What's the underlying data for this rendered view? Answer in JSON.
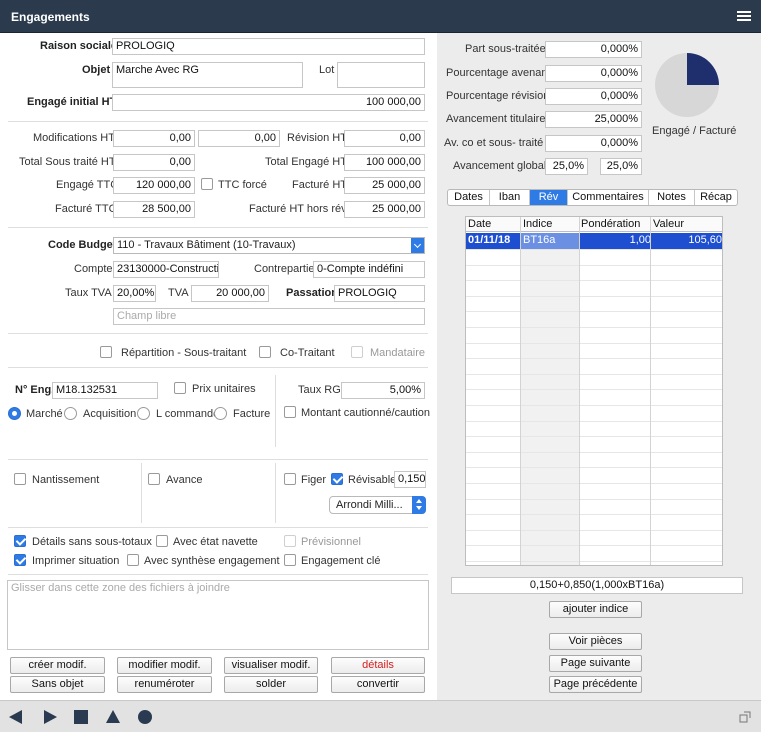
{
  "window": {
    "title": "Engagements"
  },
  "form": {
    "raison_sociale": {
      "label": "Raison sociale",
      "value": "PROLOGIQ"
    },
    "objet": {
      "label": "Objet",
      "value": "Marche Avec RG"
    },
    "lot": {
      "label": "Lot",
      "value": ""
    },
    "engage_initial": {
      "label": "Engagé initial HT",
      "value": "100 000,00"
    },
    "modifications_ht": {
      "label": "Modifications HT",
      "value1": "0,00",
      "value2": "0,00"
    },
    "revision_ht": {
      "label": "Révision HT",
      "value": "0,00"
    },
    "total_sous_traite": {
      "label": "Total Sous traité HT",
      "value": "0,00"
    },
    "total_engage_ht": {
      "label": "Total Engagé HT",
      "value": "100 000,00"
    },
    "engage_ttc": {
      "label": "Engagé TTC",
      "value": "120 000,00"
    },
    "ttc_force": {
      "label": "TTC forcé",
      "checked": false
    },
    "facture_ht": {
      "label": "Facturé HT",
      "value": "25 000,00"
    },
    "facture_ttc": {
      "label": "Facturé TTC",
      "value": "28 500,00"
    },
    "facture_ht_hors_rev": {
      "label": "Facturé HT hors rév.",
      "value": "25 000,00"
    },
    "code_budget": {
      "label": "Code Budget",
      "value": "110 - Travaux Bâtiment (10-Travaux)"
    },
    "compte": {
      "label": "Compte",
      "value": "23130000-Constructic"
    },
    "contrepartie": {
      "label": "Contrepartie",
      "value": "0-Compte indéfini"
    },
    "taux_tva": {
      "label": "Taux TVA",
      "value": "20,00%"
    },
    "tva": {
      "label": "TVA",
      "value": "20 000,00"
    },
    "passation": {
      "label": "Passation",
      "value": "PROLOGIQ"
    },
    "champ_libre": {
      "placeholder": "Champ libre"
    },
    "repartition": {
      "label": "Répartition - Sous-traitant",
      "checked": false
    },
    "co_traitant": {
      "label": "Co-Traitant",
      "checked": false
    },
    "mandataire": {
      "label": "Mandataire",
      "checked": false,
      "disabled": true
    },
    "n_eng": {
      "label": "N° Eng.",
      "value": "M18.132531"
    },
    "prix_unitaires": {
      "label": "Prix unitaires",
      "checked": false
    },
    "taux_rg": {
      "label": "Taux RG",
      "value": "5,00%"
    },
    "type_options": [
      {
        "label": "Marché",
        "selected": true
      },
      {
        "label": "Acquisition",
        "selected": false
      },
      {
        "label": "L commande",
        "selected": false
      },
      {
        "label": "Facture",
        "selected": false
      }
    ],
    "montant_caution": {
      "label": "Montant cautionné/caution",
      "checked": false
    },
    "nantissement": {
      "label": "Nantissement",
      "checked": false
    },
    "avance": {
      "label": "Avance",
      "checked": false
    },
    "figer": {
      "label": "Figer",
      "checked": false
    },
    "revisable": {
      "label": "Révisable",
      "checked": true,
      "value": "0,150"
    },
    "arrondi": {
      "value": "Arrondi Milli..."
    },
    "details_sans_sous_totaux": {
      "label": "Détails sans sous-totaux",
      "checked": true
    },
    "avec_etat_navette": {
      "label": "Avec état navette",
      "checked": false
    },
    "previsionnel": {
      "label": "Prévisionnel",
      "checked": false,
      "disabled": true
    },
    "imprimer_situation": {
      "label": "Imprimer situation",
      "checked": true
    },
    "avec_synthese": {
      "label": "Avec synthèse engagement",
      "checked": false
    },
    "engagement_cle": {
      "label": "Engagement clé",
      "checked": false
    },
    "drop_zone": {
      "placeholder": "Glisser dans cette zone des fichiers à joindre"
    }
  },
  "buttons": {
    "creer_modif": "créer modif.",
    "modifier_modif": "modifier modif.",
    "visualiser_modif": "visualiser modif.",
    "details": "détails",
    "sans_objet": "Sans objet",
    "renumeroter": "renuméroter",
    "solder": "solder",
    "convertir": "convertir",
    "ajouter_indice": "ajouter indice",
    "voir_pieces": "Voir pièces",
    "page_suivante": "Page suivante",
    "page_precedente": "Page précédente"
  },
  "summary": {
    "part_sous_traitee": {
      "label": "Part sous-traitée",
      "value": "0,000%"
    },
    "pourcentage_avenant": {
      "label": "Pourcentage avenant",
      "value": "0,000%"
    },
    "pourcentage_revision": {
      "label": "Pourcentage révision",
      "value": "0,000%"
    },
    "avancement_titulaire": {
      "label": "Avancement titulaire",
      "value": "25,000%"
    },
    "av_co_sous_traite": {
      "label": "Av. co et sous- traité",
      "value": "0,000%"
    },
    "avancement_global": {
      "label": "Avancement global",
      "value1": "25,0%",
      "value2": "25,0%"
    },
    "pie_label": "Engagé / Facturé",
    "pie_fraction": 0.25,
    "colors": {
      "pie_filled": "#1f2f6e",
      "pie_rest": "#d7d7d7",
      "accent": "#2f7be5"
    }
  },
  "tabs": [
    {
      "label": "Dates",
      "active": false
    },
    {
      "label": "Iban",
      "active": false
    },
    {
      "label": "Rév",
      "active": true
    },
    {
      "label": "Commentaires",
      "active": false
    },
    {
      "label": "Notes",
      "active": false
    },
    {
      "label": "Récap",
      "active": false
    }
  ],
  "revision_grid": {
    "columns": [
      "Date",
      "Indice",
      "Pondération",
      "Valeur"
    ],
    "rows": [
      {
        "date": "01/11/18",
        "indice": "BT16a",
        "ponderation": "1,00",
        "valeur": "105,60"
      }
    ],
    "formula": "0,150+0,850(1,000xBT16a)"
  },
  "nav": {
    "prev": "previous-triangle-icon",
    "play": "play-icon",
    "stop": "stop-square-icon",
    "up": "eject-triangle-icon",
    "record": "circle-icon",
    "resize": "resize-icon"
  }
}
